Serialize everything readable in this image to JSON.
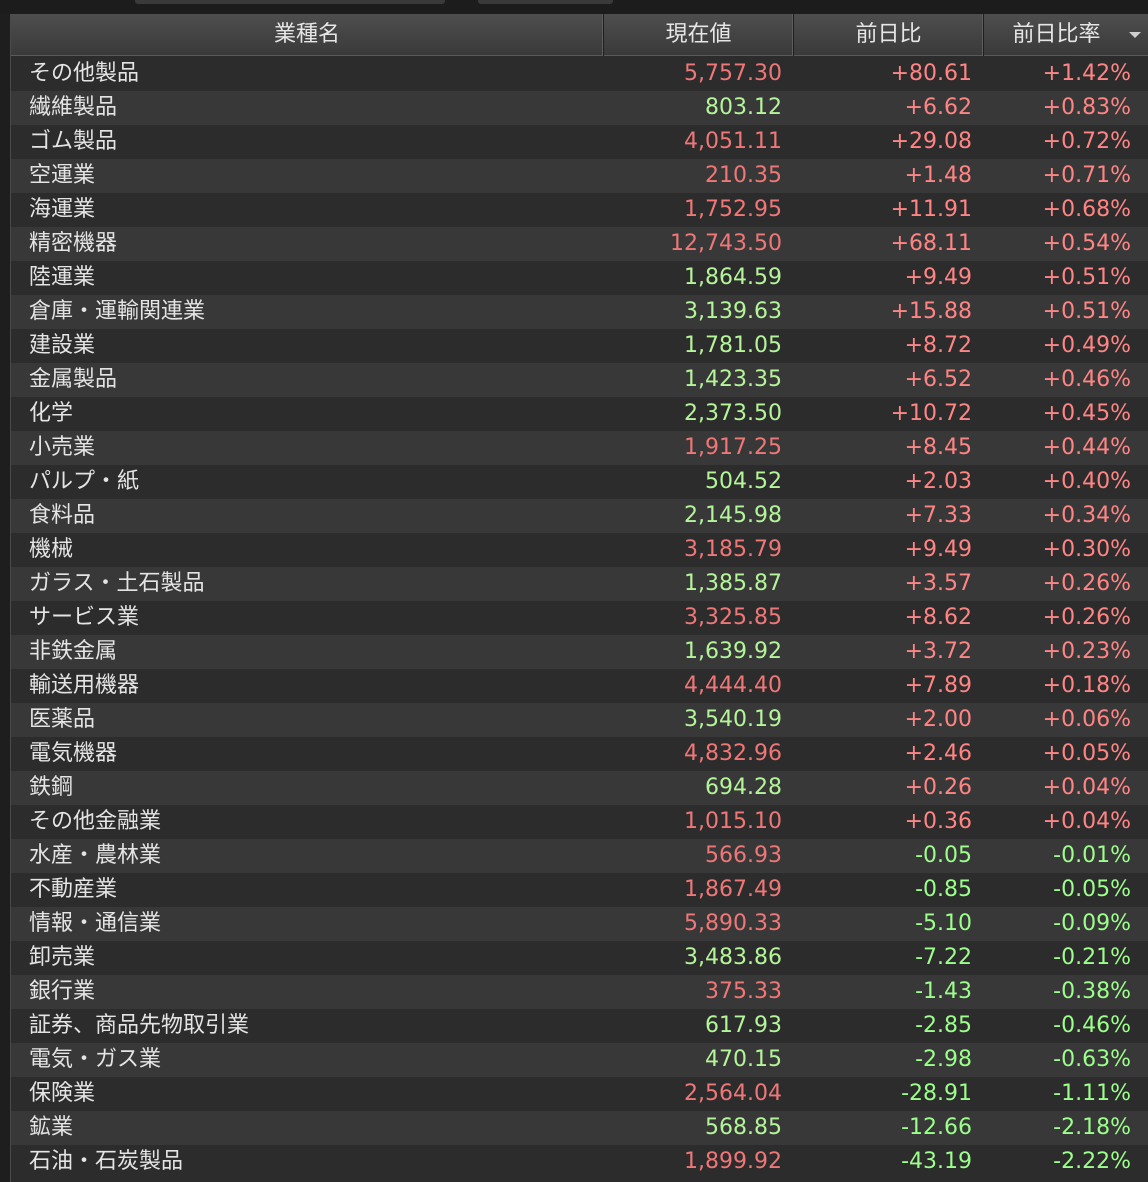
{
  "columns": {
    "name": "業種名",
    "price": "現在値",
    "change": "前日比",
    "rate": "前日比率"
  },
  "colors": {
    "up_text": "#ff8585",
    "down_text": "#9cff8c",
    "price_green": "#b5f59a",
    "price_red": "#ef7777"
  },
  "sort_icon": "chevron-down-icon",
  "rows": [
    {
      "name": "その他製品",
      "price": "5,757.30",
      "price_color": "red",
      "change": "+80.61",
      "rate": "+1.42%"
    },
    {
      "name": "繊維製品",
      "price": "803.12",
      "price_color": "green",
      "change": "+6.62",
      "rate": "+0.83%"
    },
    {
      "name": "ゴム製品",
      "price": "4,051.11",
      "price_color": "red",
      "change": "+29.08",
      "rate": "+0.72%"
    },
    {
      "name": "空運業",
      "price": "210.35",
      "price_color": "red",
      "change": "+1.48",
      "rate": "+0.71%"
    },
    {
      "name": "海運業",
      "price": "1,752.95",
      "price_color": "red",
      "change": "+11.91",
      "rate": "+0.68%"
    },
    {
      "name": "精密機器",
      "price": "12,743.50",
      "price_color": "red",
      "change": "+68.11",
      "rate": "+0.54%"
    },
    {
      "name": "陸運業",
      "price": "1,864.59",
      "price_color": "green",
      "change": "+9.49",
      "rate": "+0.51%"
    },
    {
      "name": "倉庫・運輸関連業",
      "price": "3,139.63",
      "price_color": "green",
      "change": "+15.88",
      "rate": "+0.51%"
    },
    {
      "name": "建設業",
      "price": "1,781.05",
      "price_color": "green",
      "change": "+8.72",
      "rate": "+0.49%"
    },
    {
      "name": "金属製品",
      "price": "1,423.35",
      "price_color": "green",
      "change": "+6.52",
      "rate": "+0.46%"
    },
    {
      "name": "化学",
      "price": "2,373.50",
      "price_color": "green",
      "change": "+10.72",
      "rate": "+0.45%"
    },
    {
      "name": "小売業",
      "price": "1,917.25",
      "price_color": "red",
      "change": "+8.45",
      "rate": "+0.44%"
    },
    {
      "name": "パルプ・紙",
      "price": "504.52",
      "price_color": "green",
      "change": "+2.03",
      "rate": "+0.40%"
    },
    {
      "name": "食料品",
      "price": "2,145.98",
      "price_color": "green",
      "change": "+7.33",
      "rate": "+0.34%"
    },
    {
      "name": "機械",
      "price": "3,185.79",
      "price_color": "red",
      "change": "+9.49",
      "rate": "+0.30%"
    },
    {
      "name": "ガラス・土石製品",
      "price": "1,385.87",
      "price_color": "green",
      "change": "+3.57",
      "rate": "+0.26%"
    },
    {
      "name": "サービス業",
      "price": "3,325.85",
      "price_color": "red",
      "change": "+8.62",
      "rate": "+0.26%"
    },
    {
      "name": "非鉄金属",
      "price": "1,639.92",
      "price_color": "green",
      "change": "+3.72",
      "rate": "+0.23%"
    },
    {
      "name": "輸送用機器",
      "price": "4,444.40",
      "price_color": "red",
      "change": "+7.89",
      "rate": "+0.18%"
    },
    {
      "name": "医薬品",
      "price": "3,540.19",
      "price_color": "green",
      "change": "+2.00",
      "rate": "+0.06%"
    },
    {
      "name": "電気機器",
      "price": "4,832.96",
      "price_color": "red",
      "change": "+2.46",
      "rate": "+0.05%"
    },
    {
      "name": "鉄鋼",
      "price": "694.28",
      "price_color": "green",
      "change": "+0.26",
      "rate": "+0.04%"
    },
    {
      "name": "その他金融業",
      "price": "1,015.10",
      "price_color": "red",
      "change": "+0.36",
      "rate": "+0.04%"
    },
    {
      "name": "水産・農林業",
      "price": "566.93",
      "price_color": "red",
      "change": "-0.05",
      "rate": "-0.01%"
    },
    {
      "name": "不動産業",
      "price": "1,867.49",
      "price_color": "red",
      "change": "-0.85",
      "rate": "-0.05%"
    },
    {
      "name": "情報・通信業",
      "price": "5,890.33",
      "price_color": "red",
      "change": "-5.10",
      "rate": "-0.09%"
    },
    {
      "name": "卸売業",
      "price": "3,483.86",
      "price_color": "green",
      "change": "-7.22",
      "rate": "-0.21%"
    },
    {
      "name": "銀行業",
      "price": "375.33",
      "price_color": "red",
      "change": "-1.43",
      "rate": "-0.38%"
    },
    {
      "name": "証券、商品先物取引業",
      "price": "617.93",
      "price_color": "green",
      "change": "-2.85",
      "rate": "-0.46%"
    },
    {
      "name": "電気・ガス業",
      "price": "470.15",
      "price_color": "green",
      "change": "-2.98",
      "rate": "-0.63%"
    },
    {
      "name": "保険業",
      "price": "2,564.04",
      "price_color": "red",
      "change": "-28.91",
      "rate": "-1.11%"
    },
    {
      "name": "鉱業",
      "price": "568.85",
      "price_color": "green",
      "change": "-12.66",
      "rate": "-2.18%"
    },
    {
      "name": "石油・石炭製品",
      "price": "1,899.92",
      "price_color": "red",
      "change": "-43.19",
      "rate": "-2.22%"
    }
  ]
}
